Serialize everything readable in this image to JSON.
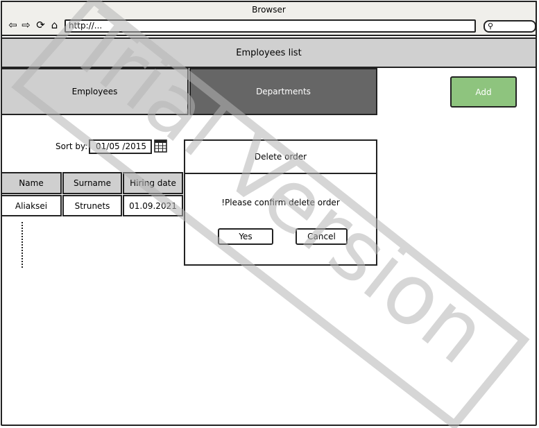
{
  "browser": {
    "title": "Browser",
    "url": "http://...",
    "icons": [
      "back-arrow-icon",
      "forward-arrow-icon",
      "refresh-icon",
      "home-icon",
      "search-icon"
    ]
  },
  "header": {
    "title": "Employees list"
  },
  "tabs": [
    {
      "label": "Employees",
      "active": false,
      "color": "#cfcfcf"
    },
    {
      "label": "Departments",
      "active": true,
      "color": "#666666"
    }
  ],
  "add_button": {
    "label": "Add",
    "color": "#8ec47e"
  },
  "sort": {
    "label": "Sort by:",
    "value": "01/05 /2015"
  },
  "table": {
    "columns": [
      "Name",
      "Surname",
      "Hiring date"
    ],
    "rows": [
      [
        "Aliaksei",
        "Strunets",
        "01.09.2021"
      ]
    ]
  },
  "dialog": {
    "title": "Delete order",
    "message": "!Please confirm delete order",
    "yes_label": "Yes",
    "cancel_label": "Cancel"
  },
  "watermark": {
    "text": "Trial Version"
  }
}
